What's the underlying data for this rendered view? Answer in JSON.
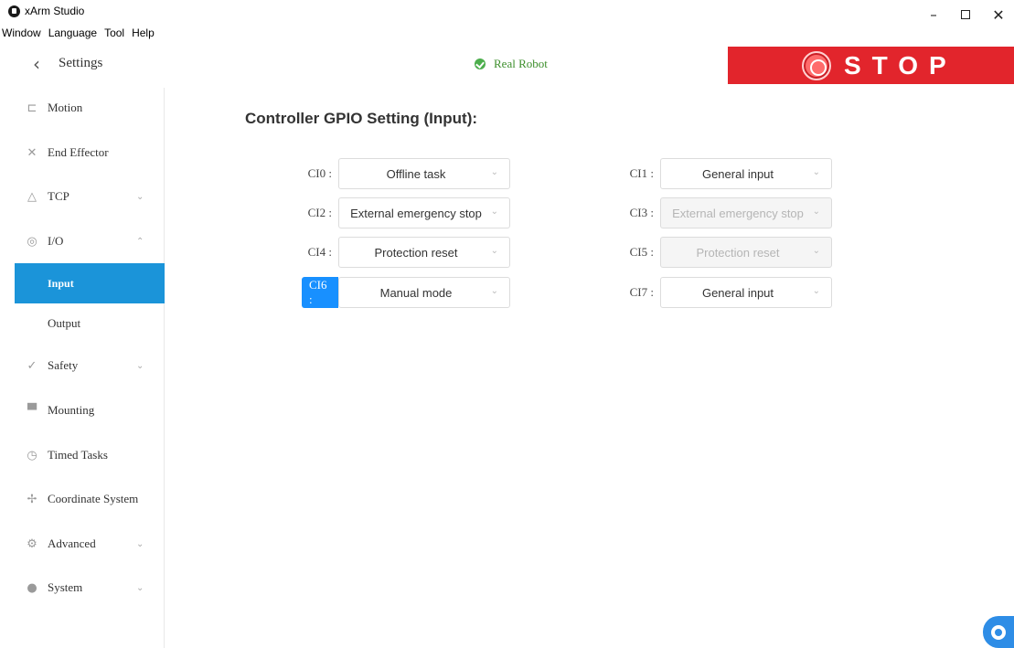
{
  "window": {
    "title": "xArm Studio",
    "menu": [
      "Window",
      "Language",
      "Tool",
      "Help"
    ],
    "controls": {
      "minimize": "–",
      "close": "✕"
    }
  },
  "header": {
    "back_glyph": "‹",
    "title": "Settings",
    "robot_status": "Real Robot",
    "stop_label": "STOP"
  },
  "sidebar": {
    "items": [
      {
        "label": "Motion",
        "icon": "motion-icon"
      },
      {
        "label": "End Effector",
        "icon": "end-effector-icon"
      },
      {
        "label": "TCP",
        "icon": "tcp-icon",
        "chevron": "⌄"
      },
      {
        "label": "I/O",
        "icon": "io-icon",
        "chevron": "⌃"
      },
      {
        "label": "Input",
        "active": true
      },
      {
        "label": "Output"
      },
      {
        "label": "Safety",
        "icon": "safety-icon",
        "chevron": "⌄"
      },
      {
        "label": "Mounting",
        "icon": "mounting-icon"
      },
      {
        "label": "Timed Tasks",
        "icon": "timed-tasks-icon"
      },
      {
        "label": "Coordinate System",
        "icon": "coordinate-system-icon"
      },
      {
        "label": "Advanced",
        "icon": "advanced-icon",
        "chevron": "⌄"
      },
      {
        "label": "System",
        "icon": "system-icon",
        "chevron": "⌄"
      }
    ]
  },
  "main": {
    "title": "Controller GPIO Setting (Input):",
    "gpio": [
      {
        "label": "CI0 :",
        "value": "Offline task",
        "disabled": false
      },
      {
        "label": "CI1 :",
        "value": "General input",
        "disabled": false
      },
      {
        "label": "CI2 :",
        "value": "External emergency stop",
        "disabled": false
      },
      {
        "label": "CI3 :",
        "value": "External emergency stop",
        "disabled": true
      },
      {
        "label": "CI4 :",
        "value": "Protection reset",
        "disabled": false
      },
      {
        "label": "CI5 :",
        "value": "Protection reset",
        "disabled": true
      },
      {
        "label": "CI6 :",
        "value": "Manual mode",
        "disabled": false,
        "highlighted": true
      },
      {
        "label": "CI7 :",
        "value": "General input",
        "disabled": false
      }
    ],
    "chevron": "⌄"
  },
  "colors": {
    "accent": "#1b94d9",
    "stop_red": "#e2252c",
    "status_green": "#4cae4c"
  }
}
